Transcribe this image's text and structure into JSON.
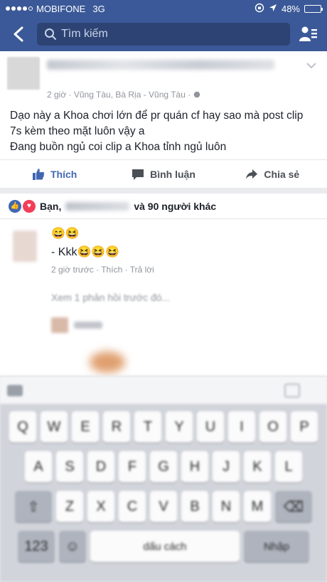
{
  "status_bar": {
    "carrier": "MOBIFONE",
    "network": "3G",
    "battery_text": "48%",
    "battery_level": 0.48
  },
  "nav": {
    "search_placeholder": "Tìm kiếm"
  },
  "post": {
    "meta": "2 giờ · Vũng Tàu, Bà Rịa - Vũng Tàu ·",
    "text_line1": "Dạo này a Khoa chơi lớn để pr quán cf hay sao mà post clip",
    "text_line2": "7s kèm theo mặt luôn vậy a",
    "text_line3": "Đang buồn ngủ coi clip a Khoa tỉnh ngủ luôn",
    "actions": {
      "like": "Thích",
      "comment": "Bình luận",
      "share": "Chia sẻ"
    }
  },
  "reactions": {
    "prefix": "Bạn,",
    "suffix": "và 90 người khác"
  },
  "comment": {
    "line1": "😄😆",
    "line2": "- Kkk😆😆😆",
    "meta": "2 giờ trước · Thích · Trả lời",
    "more": "Xem 1 phản hồi trước đó..."
  },
  "keyboard": {
    "row1": [
      "Q",
      "W",
      "E",
      "R",
      "T",
      "Y",
      "U",
      "I",
      "O",
      "P"
    ],
    "row2": [
      "A",
      "S",
      "D",
      "F",
      "G",
      "H",
      "J",
      "K",
      "L"
    ],
    "row3": [
      "Z",
      "X",
      "C",
      "V",
      "B",
      "N",
      "M"
    ],
    "space": "dấu cách",
    "return": "Nhập"
  }
}
